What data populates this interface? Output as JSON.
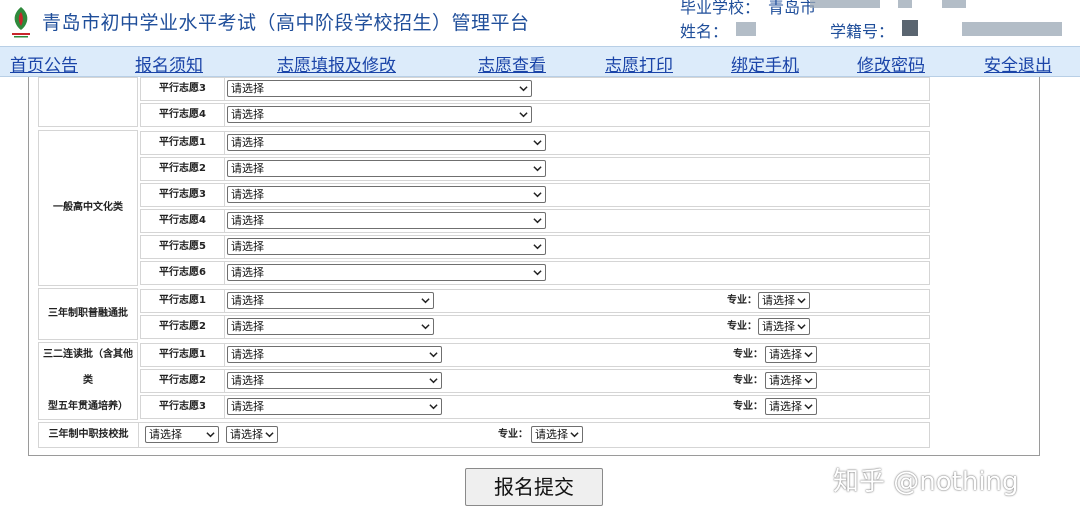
{
  "header": {
    "site_title": "青岛市初中学业水平考试（高中阶段学校招生）管理平台",
    "school_label": "毕业学校：",
    "school_value": "青岛市",
    "name_label": "姓名：",
    "student_id_label": "学籍号："
  },
  "nav": {
    "items": [
      {
        "label": "首页公告"
      },
      {
        "label": "报名须知"
      },
      {
        "label": "志愿填报及修改"
      },
      {
        "label": "志愿查看"
      },
      {
        "label": "志愿打印"
      },
      {
        "label": "绑定手机"
      },
      {
        "label": "修改密码"
      },
      {
        "label": "安全退出"
      }
    ]
  },
  "form": {
    "select_placeholder": "请选择",
    "major_label": "专业：",
    "top_rows": [
      {
        "label": "平行志愿3",
        "value": "请选择"
      },
      {
        "label": "平行志愿4",
        "value": "请选择"
      }
    ],
    "general": {
      "category": "一般高中文化类",
      "rows": [
        {
          "label": "平行志愿1",
          "value": "请选择"
        },
        {
          "label": "平行志愿2",
          "value": "请选择"
        },
        {
          "label": "平行志愿3",
          "value": "请选择"
        },
        {
          "label": "平行志愿4",
          "value": "请选择"
        },
        {
          "label": "平行志愿5",
          "value": "请选择"
        },
        {
          "label": "平行志愿6",
          "value": "请选择"
        }
      ]
    },
    "vocational": {
      "category": "三年制职普融通批",
      "rows": [
        {
          "label": "平行志愿1",
          "value": "请选择",
          "major": "请选择"
        },
        {
          "label": "平行志愿2",
          "value": "请选择",
          "major": "请选择"
        }
      ]
    },
    "two_three": {
      "category_line1": "三二连读批（含其他类",
      "category_line2": "型五年贯通培养）",
      "rows": [
        {
          "label": "平行志愿1",
          "value": "请选择",
          "major": "请选择"
        },
        {
          "label": "平行志愿2",
          "value": "请选择",
          "major": "请选择"
        },
        {
          "label": "平行志愿3",
          "value": "请选择",
          "major": "请选择"
        }
      ]
    },
    "technical": {
      "category": "三年制中职技校批",
      "select1": "请选择",
      "select2": "请选择",
      "major": "请选择"
    }
  },
  "submit_label": "报名提交",
  "watermark": "知乎 @nothing",
  "colors": {
    "title_blue": "#1f4e9a",
    "nav_bg": "#dcebfa",
    "nav_link": "#1a44a8",
    "border": "#d5d5d5"
  }
}
